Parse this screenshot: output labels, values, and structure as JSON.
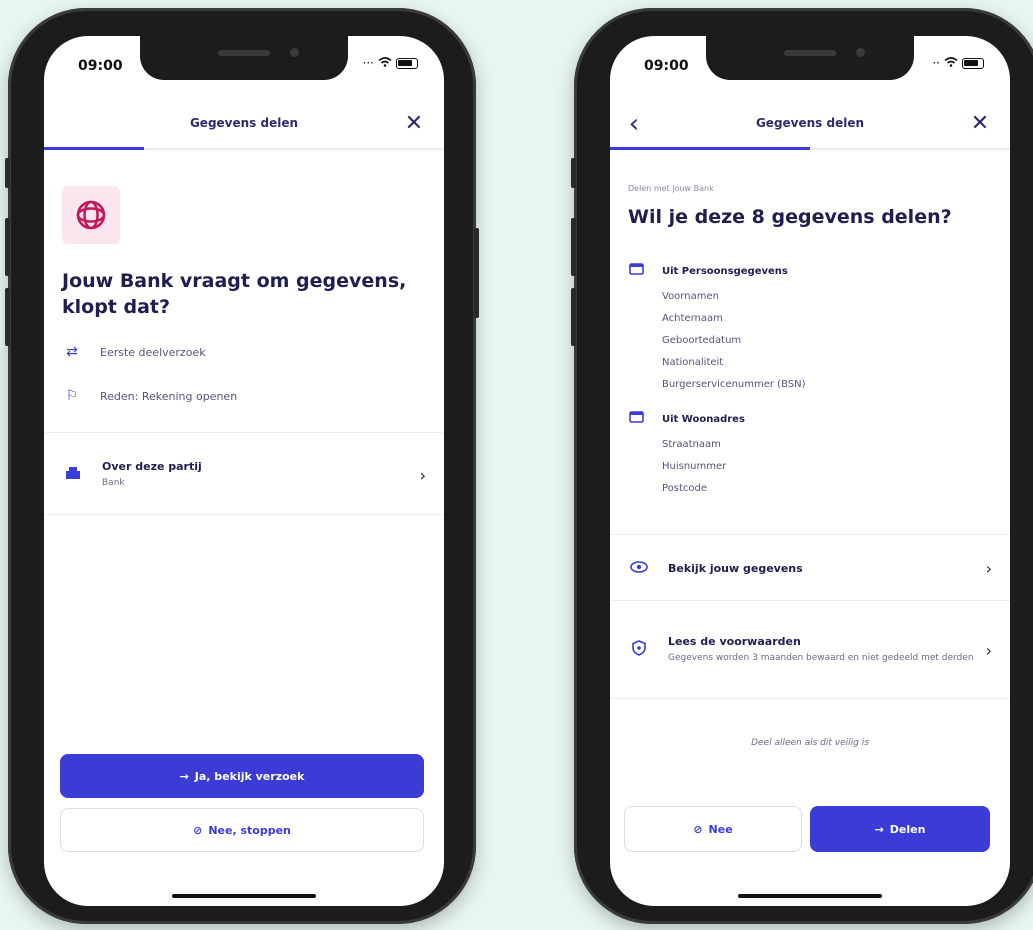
{
  "status_time": "09:00",
  "screen1": {
    "header_title": "Gegevens delen",
    "progress": 0.25,
    "title": "Jouw Bank vraagt om gegevens, klopt dat?",
    "info_rows": [
      {
        "icon": "arrows-icon",
        "text": "Eerste deelverzoek"
      },
      {
        "icon": "flag-icon",
        "text": "Reden: Rekening openen"
      }
    ],
    "party": {
      "title": "Over deze partij",
      "subtitle": "Bank"
    },
    "primary_button": "Ja, bekijk verzoek",
    "secondary_button": "Nee, stoppen"
  },
  "screen2": {
    "header_title": "Gegevens delen",
    "progress": 0.5,
    "small_label": "Delen met Jouw Bank",
    "title": "Wil je deze 8 gegevens delen?",
    "sections": [
      {
        "title": "Uit Persoonsgegevens",
        "items": [
          "Voornamen",
          "Achternaam",
          "Geboortedatum",
          "Nationaliteit",
          "Burgerservicenummer (BSN)"
        ]
      },
      {
        "title": "Uit Woonadres",
        "items": [
          "Straatnaam",
          "Huisnummer",
          "Postcode"
        ]
      }
    ],
    "view_row": "Bekijk jouw gegevens",
    "terms_row": {
      "title": "Lees de voorwaarden",
      "subtitle": "Gegevens worden 3 maanden bewaard en niet gedeeld met derden"
    },
    "footnote": "Deel alleen als dit veilig is",
    "no_button": "Nee",
    "share_button": "Delen"
  },
  "colors": {
    "accent": "#3b3bd6",
    "title": "#1e1e50",
    "background": "#e8f6f3",
    "logo_bg": "#fbe5ee",
    "logo": "#c2185b"
  }
}
